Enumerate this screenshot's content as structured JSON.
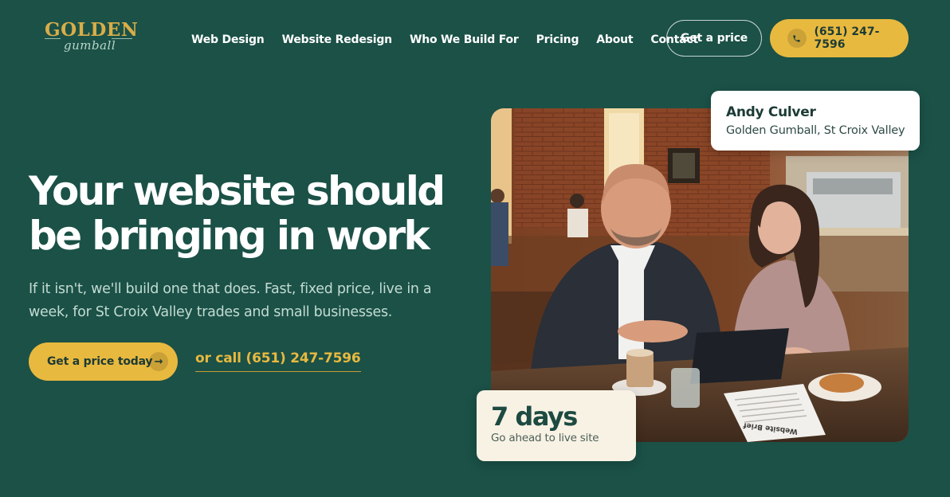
{
  "brand": {
    "logo_word": "GOLDEN",
    "logo_script": "gumball",
    "accent_color": "#e8b93f",
    "background_color": "#1b5147"
  },
  "nav": {
    "items": [
      {
        "label": "Web Design"
      },
      {
        "label": "Website Redesign"
      },
      {
        "label": "Who We Build For"
      },
      {
        "label": "Pricing"
      },
      {
        "label": "About"
      },
      {
        "label": "Contact"
      }
    ]
  },
  "header": {
    "get_price_label": "Get a price",
    "phone_label": "(651) 247-7596",
    "phone_icon": "phone-icon"
  },
  "hero": {
    "title_line1": "Your website should",
    "title_line2": "be bringing in work",
    "subtitle": "If it isn't, we'll build one that does. Fast, fixed price, live in a week, for St Croix Valley trades and small businesses.",
    "cta_label": "Get a price today",
    "cta_icon": "arrow-right-icon",
    "call_label": "or call (651) 247-7596"
  },
  "photo_card": {
    "name": "Andy Culver",
    "location": "Golden Gumball, St Croix Valley",
    "stat_value": "7 days",
    "stat_label": "Go ahead to live site",
    "document_text": "Website Brief"
  }
}
